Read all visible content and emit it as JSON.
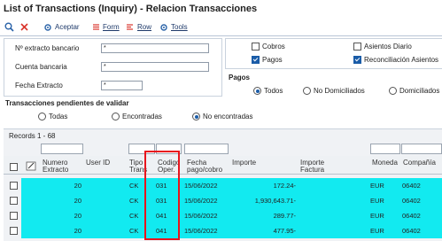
{
  "window": {
    "title": "List of Transactions (Inquiry) - Relacion Transacciones"
  },
  "toolbar": {
    "search_icon": "search-icon",
    "close_icon": "close-icon",
    "accept_label": "Aceptar",
    "form_label": "Form",
    "row_label": "Row",
    "tools_label": "Tools"
  },
  "filters": {
    "numero_extracto": {
      "label": "Nº extracto bancario",
      "value": "*"
    },
    "cuenta_bancaria": {
      "label": "Cuenta bancaria",
      "value": "*"
    },
    "fecha_extracto": {
      "label": "Fecha Extracto",
      "value": "*"
    }
  },
  "options": {
    "cobros": {
      "label": "Cobros",
      "checked": false
    },
    "asientos_diario": {
      "label": "Asientos Diario",
      "checked": false
    },
    "pagos": {
      "label": "Pagos",
      "checked": true
    },
    "reconciliacion": {
      "label": "Reconciliación Asientos",
      "checked": true
    }
  },
  "pagos_group": {
    "title": "Pagos",
    "radios": [
      "Todos",
      "No Domiciliados",
      "Domiciliados"
    ],
    "selected": "Todos"
  },
  "pending_group": {
    "title": "Transacciones pendientes de validar",
    "radios": [
      "Todas",
      "Encontradas",
      "No encontradas"
    ],
    "selected": "No encontradas"
  },
  "grid": {
    "records_label": "Records 1 - 68",
    "columns": [
      "Numero Extracto",
      "User ID",
      "Tipo Trans",
      "Codigo Oper.",
      "Fecha pago/cobro",
      "Importe",
      "Importe Factura",
      "Moneda",
      "Compañía"
    ],
    "rows": [
      {
        "numero": "20",
        "user": "",
        "tipo": "CK",
        "codigo": "031",
        "fecha": "15/06/2022",
        "importe": "172.24-",
        "importe_factura": "",
        "moneda": "EUR",
        "compania": "06402"
      },
      {
        "numero": "20",
        "user": "",
        "tipo": "CK",
        "codigo": "031",
        "fecha": "15/06/2022",
        "importe": "1,930,643.71-",
        "importe_factura": "",
        "moneda": "EUR",
        "compania": "06402"
      },
      {
        "numero": "20",
        "user": "",
        "tipo": "CK",
        "codigo": "041",
        "fecha": "15/06/2022",
        "importe": "289.77-",
        "importe_factura": "",
        "moneda": "EUR",
        "compania": "06402"
      },
      {
        "numero": "20",
        "user": "",
        "tipo": "CK",
        "codigo": "041",
        "fecha": "15/06/2022",
        "importe": "477.95-",
        "importe_factura": "",
        "moneda": "EUR",
        "compania": "06402"
      }
    ]
  },
  "colors": {
    "row_highlight": "#12eaf0",
    "annotation_box": "#e8141c",
    "accent": "#1a5ca8"
  }
}
